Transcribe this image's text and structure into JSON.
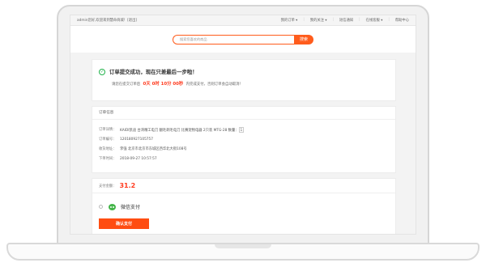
{
  "topbar": {
    "welcome": "admin您好,欢迎来到慧命商城！[退出]",
    "nav": [
      "我的订单",
      "我的关注",
      "短信通知",
      "在线客服",
      "帮助中心"
    ],
    "dropdown_marks": [
      "▾",
      "▾",
      "",
      "▾",
      ""
    ]
  },
  "search": {
    "placeholder": "搜索您喜欢的商品",
    "button_label": "搜索"
  },
  "success": {
    "title": "订单提交成功，现在只差最后一步啦！",
    "prefix": "请您在提交订单后",
    "countdown": "0天 0时 10分 00秒",
    "suffix": "内完成支付，否则订单会自动取消！"
  },
  "order_info": {
    "header": "订单信息",
    "rows": [
      {
        "key": "订单详情：",
        "value": "KAIDI凯迪 台湾精工电刀 翻毛剃毛电刀 比赛宠物电器 2只装 MTG-28 数量：",
        "qty": "1"
      },
      {
        "key": "订单编号：",
        "value": "120180927105757",
        "qty": ""
      },
      {
        "key": "收货地址：",
        "value": "李强 北京市北京市东城区西华北大街108号",
        "qty": ""
      },
      {
        "key": "下单时间：",
        "value": "2018-09-27 10:57:57",
        "qty": ""
      }
    ]
  },
  "payment": {
    "amount_label": "支付金额：",
    "amount": "31.2",
    "method": "微信支付",
    "confirm_label": "确认支付"
  },
  "colors": {
    "accent": "#ff5c1c",
    "price": "#ff3b1f",
    "success": "#20b24a",
    "wechat": "#44b549"
  }
}
